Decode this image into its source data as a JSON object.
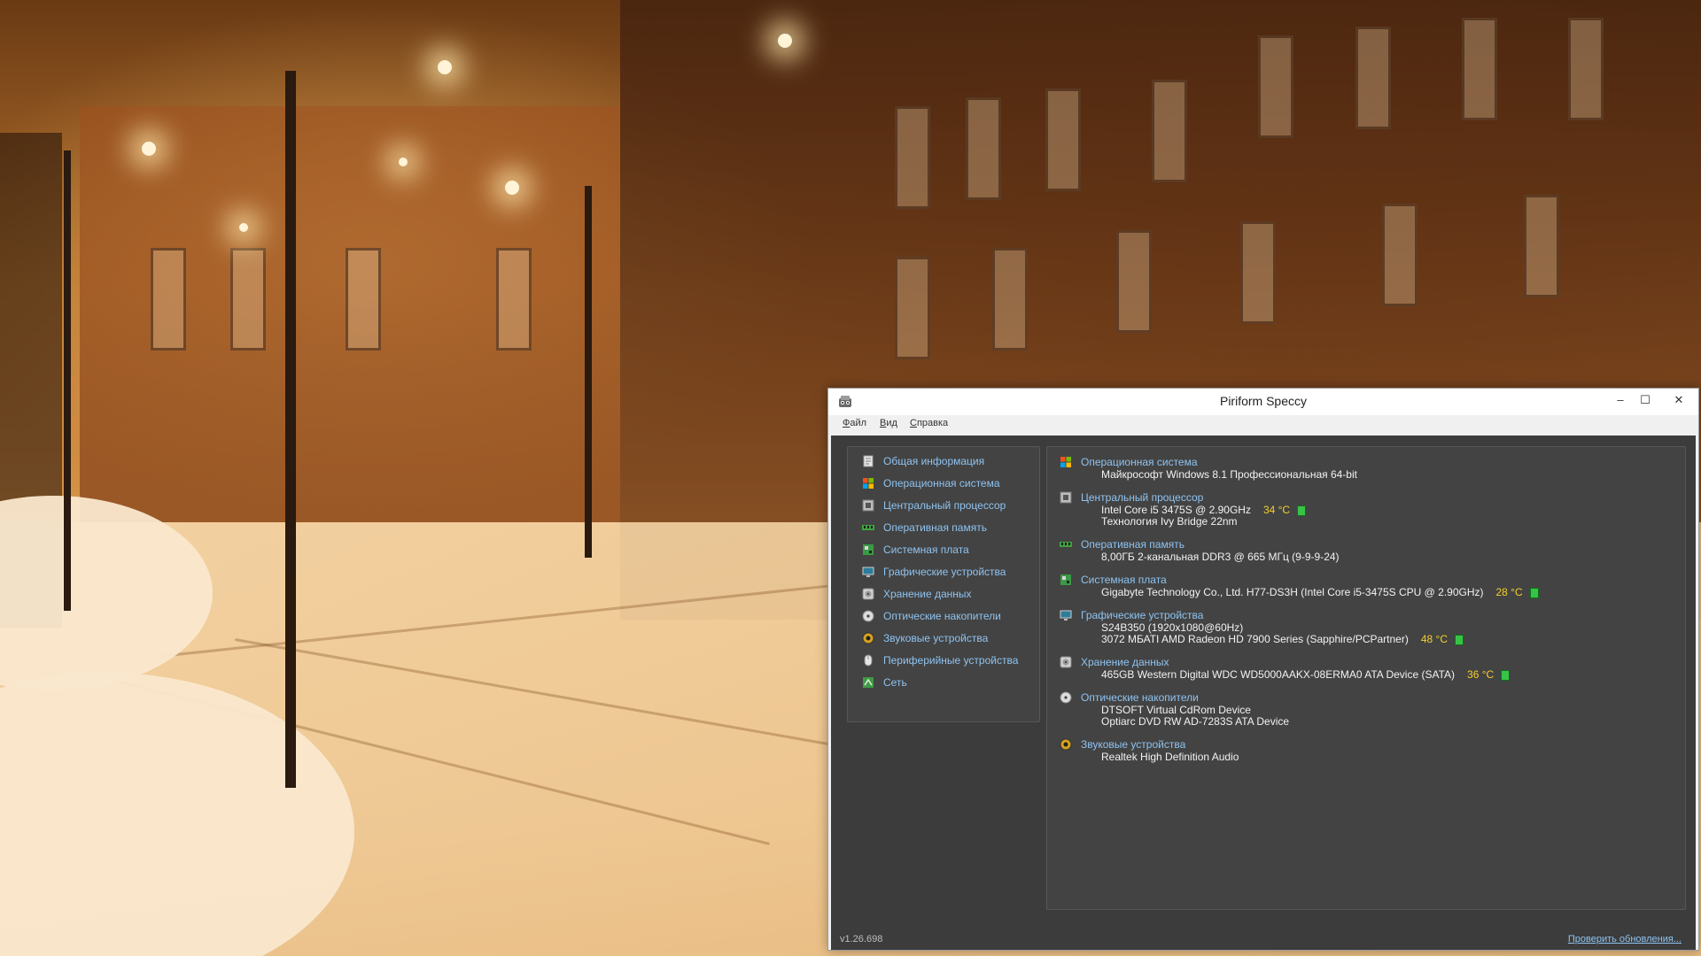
{
  "window": {
    "title": "Piriform Speccy",
    "controls": {
      "minimize": "–",
      "maximize": "☐",
      "close": "✕"
    }
  },
  "menu": [
    "Файл",
    "Вид",
    "Справка"
  ],
  "nav": [
    {
      "label": "Общая информация",
      "icon": "summary-icon"
    },
    {
      "label": "Операционная система",
      "icon": "windows-icon"
    },
    {
      "label": "Центральный процессор",
      "icon": "cpu-icon"
    },
    {
      "label": "Оперативная память",
      "icon": "ram-icon"
    },
    {
      "label": "Системная плата",
      "icon": "motherboard-icon"
    },
    {
      "label": "Графические устройства",
      "icon": "monitor-icon"
    },
    {
      "label": "Хранение данных",
      "icon": "hdd-icon"
    },
    {
      "label": "Оптические накопители",
      "icon": "optical-disc-icon"
    },
    {
      "label": "Звуковые устройства",
      "icon": "speaker-icon"
    },
    {
      "label": "Периферийные устройства",
      "icon": "mouse-icon"
    },
    {
      "label": "Сеть",
      "icon": "network-icon"
    }
  ],
  "summary": [
    {
      "title": "Операционная система",
      "icon": "windows-icon",
      "lines": [
        {
          "text": "Майкрософт Windows 8.1 Профессиональная 64-bit"
        }
      ]
    },
    {
      "title": "Центральный процессор",
      "icon": "cpu-icon",
      "lines": [
        {
          "text": "Intel Core i5 3475S @ 2.90GHz",
          "temp": "34 °C"
        },
        {
          "text": "Технология Ivy Bridge 22nm"
        }
      ]
    },
    {
      "title": "Оперативная память",
      "icon": "ram-icon",
      "lines": [
        {
          "text": "8,00ГБ 2-канальная DDR3 @ 665 МГц (9-9-9-24)"
        }
      ]
    },
    {
      "title": "Системная плата",
      "icon": "motherboard-icon",
      "lines": [
        {
          "text": "Gigabyte Technology Co., Ltd. H77-DS3H (Intel Core i5-3475S CPU @ 2.90GHz)",
          "temp": "28 °C"
        }
      ]
    },
    {
      "title": "Графические устройства",
      "icon": "monitor-icon",
      "lines": [
        {
          "text": "S24B350 (1920x1080@60Hz)"
        },
        {
          "text": "3072 МБАТI AMD Radeon HD 7900 Series (Sapphire/PCPartner)",
          "temp": "48 °C"
        }
      ]
    },
    {
      "title": "Хранение данных",
      "icon": "hdd-icon",
      "lines": [
        {
          "text": "465GB Western Digital WDC WD5000AAKX-08ERMA0 ATA Device (SATA)",
          "temp": "36 °C"
        }
      ]
    },
    {
      "title": "Оптические накопители",
      "icon": "optical-disc-icon",
      "lines": [
        {
          "text": "DTSOFT Virtual CdRom Device"
        },
        {
          "text": "Optiarc DVD RW AD-7283S ATA Device"
        }
      ]
    },
    {
      "title": "Звуковые устройства",
      "icon": "speaker-icon",
      "lines": [
        {
          "text": "Realtek High Definition Audio"
        }
      ]
    }
  ],
  "status": {
    "version": "v1.26.698",
    "update_link": "Проверить обновления..."
  },
  "colors": {
    "accent_link": "#8ec3f0",
    "temperature": "#f4cf2a",
    "temp_ok": "#37c446",
    "panel_bg": "#434343"
  }
}
